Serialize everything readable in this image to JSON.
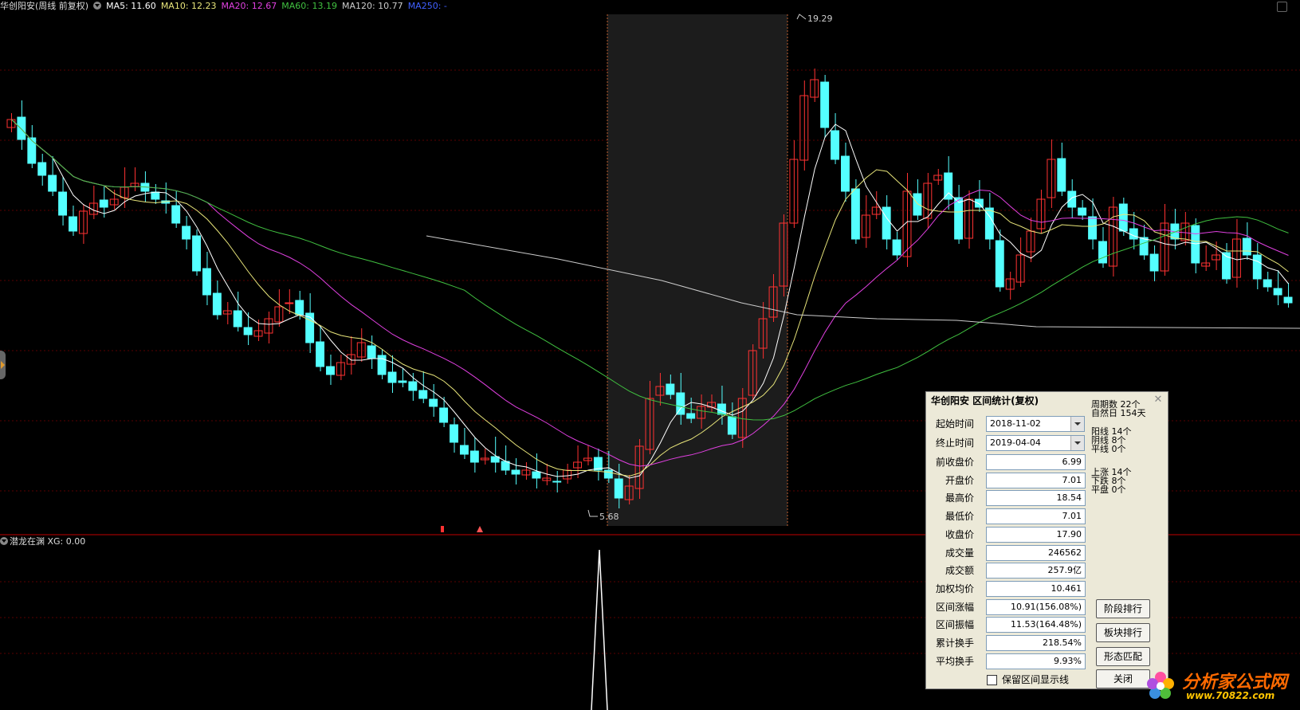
{
  "header": {
    "stock": "华创阳安(周线 前复权)",
    "ma": [
      {
        "label": "MA5: 11.60",
        "color": "#ffffff"
      },
      {
        "label": "MA10: 12.23",
        "color": "#e8e57a"
      },
      {
        "label": "MA20: 12.67",
        "color": "#e040e0"
      },
      {
        "label": "MA60: 13.19",
        "color": "#40c040"
      },
      {
        "label": "MA120: 10.77",
        "color": "#cccccc"
      },
      {
        "label": "MA250: -",
        "color": "#4060ff"
      }
    ]
  },
  "chart": {
    "high_label": "19.29",
    "low_label": "5.68"
  },
  "indicator": {
    "label": "潜龙在渊 XG: 0.00"
  },
  "dialog": {
    "title": "华创阳安 区间统计(复权)",
    "start_label": "起始时间",
    "start_value": "2018-11-02",
    "end_label": "终止时间",
    "end_value": "2019-04-04",
    "rows": [
      {
        "label": "前收盘价",
        "value": "6.99"
      },
      {
        "label": "开盘价",
        "value": "7.01"
      },
      {
        "label": "最高价",
        "value": "18.54"
      },
      {
        "label": "最低价",
        "value": "7.01"
      },
      {
        "label": "收盘价",
        "value": "17.90"
      },
      {
        "label": "成交量",
        "value": "246562"
      },
      {
        "label": "成交额",
        "value": "257.9亿"
      },
      {
        "label": "加权均价",
        "value": "10.461"
      },
      {
        "label": "区间涨幅",
        "value": "10.91(156.08%)"
      },
      {
        "label": "区间振幅",
        "value": "11.53(164.48%)"
      },
      {
        "label": "累计换手",
        "value": "218.54%"
      },
      {
        "label": "平均换手",
        "value": "9.93%"
      }
    ],
    "stats": {
      "periods": "周期数  22个",
      "days": "自然日  154天",
      "yang": "阳线  14个",
      "yin": "阴线  8个",
      "flat": "平线  0个",
      "up": "上涨  14个",
      "down": "下跌  8个",
      "even": "平盘  0个"
    },
    "buttons": {
      "stage": "阶段排行",
      "sector": "板块排行",
      "pattern": "形态匹配",
      "close": "关闭"
    },
    "checkbox": "保留区间显示线"
  },
  "watermark": {
    "text": "分析家公式网",
    "url": "www.70822.com"
  }
}
